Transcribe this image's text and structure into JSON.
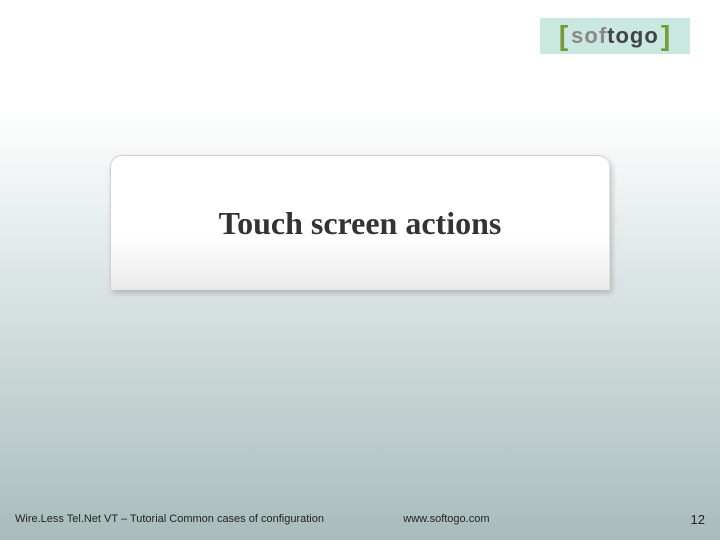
{
  "logo": {
    "bracket_left": "[",
    "sof": "sof",
    "togo": "togo",
    "bracket_right": "]"
  },
  "main": {
    "title": "Touch screen actions"
  },
  "footer": {
    "left": "Wire.Less Tel.Net VT – Tutorial Common cases of configuration",
    "center": "www.softogo.com",
    "page": "12"
  }
}
